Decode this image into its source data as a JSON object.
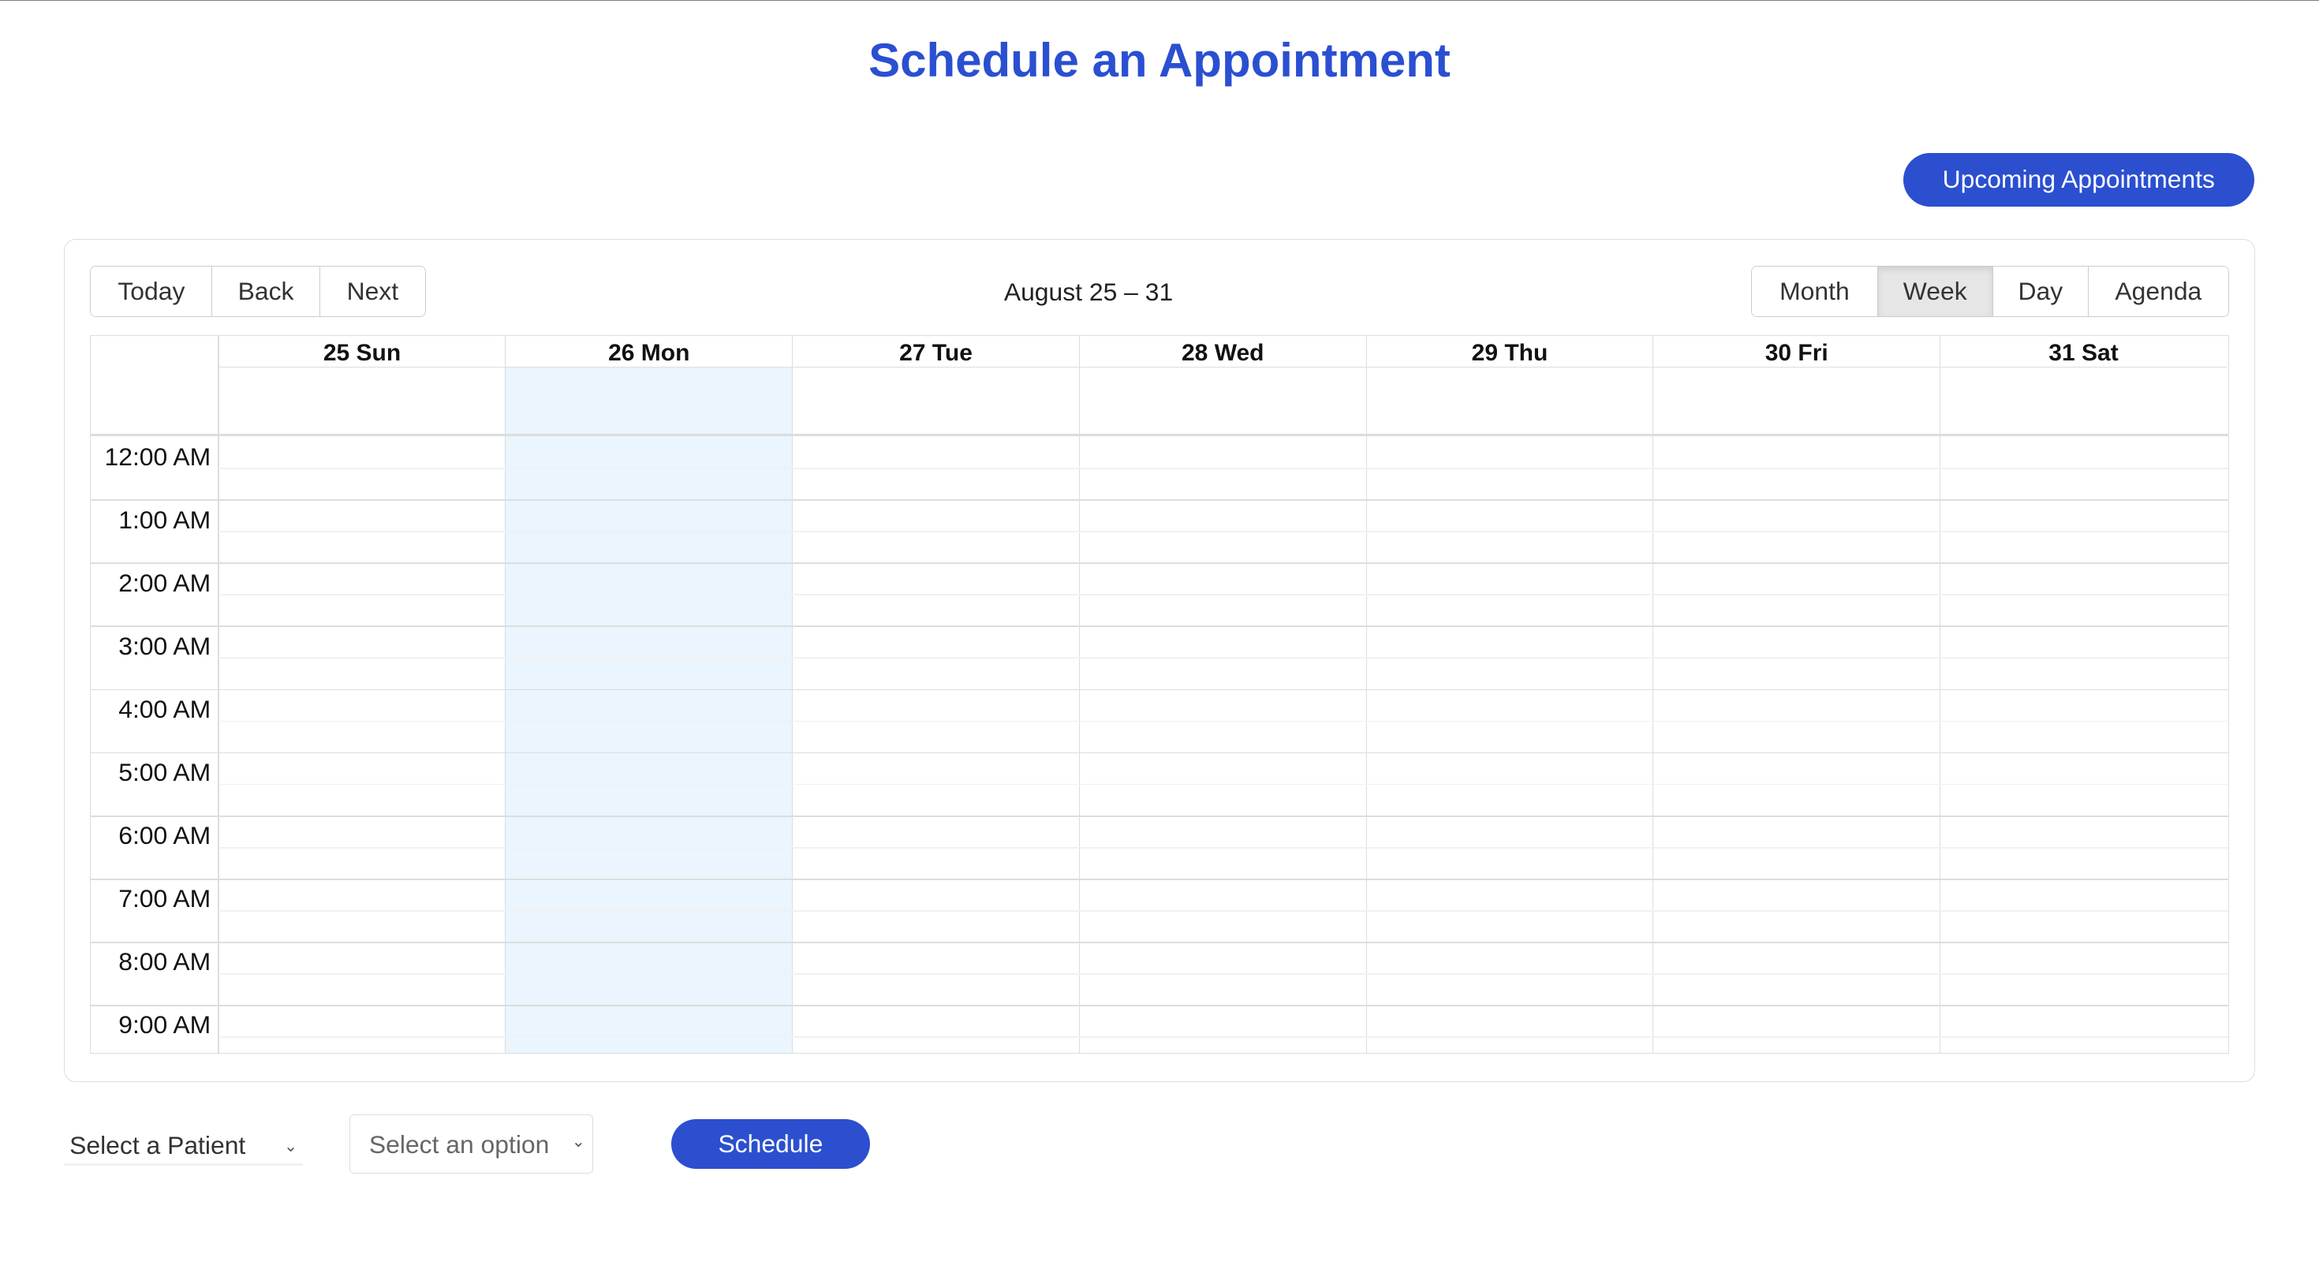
{
  "title": "Schedule an Appointment",
  "upcoming_label": "Upcoming Appointments",
  "toolbar": {
    "nav": [
      "Today",
      "Back",
      "Next"
    ],
    "range_label": "August 25 – 31",
    "views": [
      "Month",
      "Week",
      "Day",
      "Agenda"
    ],
    "active_view": "Week"
  },
  "days": [
    "25 Sun",
    "26 Mon",
    "27 Tue",
    "28 Wed",
    "29 Thu",
    "30 Fri",
    "31 Sat"
  ],
  "today_index": 1,
  "times": [
    "12:00 AM",
    "1:00 AM",
    "2:00 AM",
    "3:00 AM",
    "4:00 AM",
    "5:00 AM",
    "6:00 AM",
    "7:00 AM",
    "8:00 AM",
    "9:00 AM"
  ],
  "form": {
    "patient_placeholder": "Select a Patient",
    "option_placeholder": "Select an option",
    "schedule_label": "Schedule"
  },
  "colors": {
    "accent": "#2b4fcf",
    "today_bg": "#eaf5fd"
  }
}
